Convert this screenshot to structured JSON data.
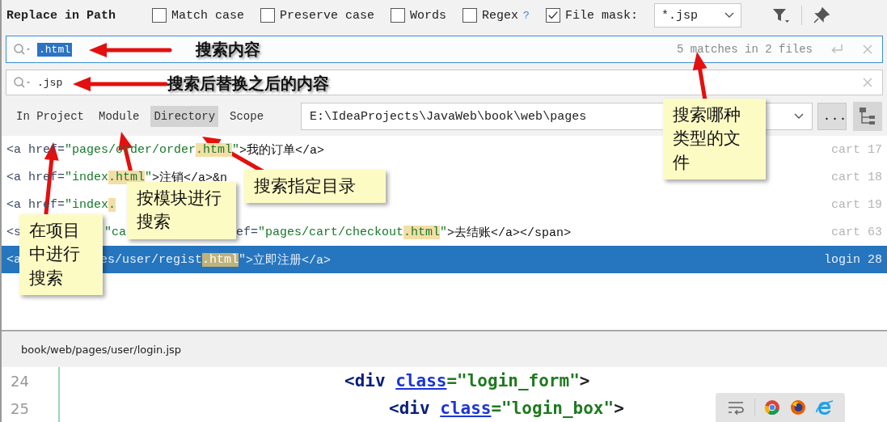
{
  "dialog_title": "Replace in Path",
  "options": [
    {
      "label": "Match case",
      "checked": false
    },
    {
      "label": "Preserve case",
      "checked": false
    },
    {
      "label": "Words",
      "checked": false
    },
    {
      "label": "Regex",
      "checked": false,
      "help": "?"
    },
    {
      "label": "File mask:",
      "checked": true
    }
  ],
  "file_mask": {
    "value": "*.jsp"
  },
  "search_field": {
    "value": ".html",
    "status": "5 matches in 2 files"
  },
  "replace_field": {
    "value": ".jsp"
  },
  "scopes": [
    {
      "label": "In Project",
      "selected": false
    },
    {
      "label": "Module",
      "selected": false
    },
    {
      "label": "Directory",
      "selected": true
    },
    {
      "label": "Scope",
      "selected": false
    }
  ],
  "directory": {
    "value": "E:\\IdeaProjects\\JavaWeb\\book\\web\\pages"
  },
  "more_button": {
    "label": "..."
  },
  "results": [
    {
      "segments": [
        {
          "kind": "tag",
          "text": "<a href="
        },
        {
          "kind": "str",
          "text": "\"pages/order/order"
        },
        {
          "kind": "match",
          "text": ".html"
        },
        {
          "kind": "str",
          "text": "\""
        },
        {
          "kind": "text",
          "text": ">我的订单</a>"
        }
      ],
      "file": "cart",
      "line": "17",
      "selected": false
    },
    {
      "segments": [
        {
          "kind": "tag",
          "text": "<a href="
        },
        {
          "kind": "str",
          "text": "\"index"
        },
        {
          "kind": "match",
          "text": ".html"
        },
        {
          "kind": "str",
          "text": "\""
        },
        {
          "kind": "text",
          "text": ">注销</a>&n"
        }
      ],
      "file": "cart",
      "line": "18",
      "selected": false
    },
    {
      "segments": [
        {
          "kind": "tag",
          "text": "<a href="
        },
        {
          "kind": "str",
          "text": "\"index"
        },
        {
          "kind": "match",
          "text": "."
        }
      ],
      "file": "cart",
      "line": "19",
      "selected": false
    },
    {
      "segments": [
        {
          "kind": "tag",
          "text": "<s"
        },
        {
          "kind": "covered"
        },
        {
          "kind": "str",
          "text": "\"ca"
        },
        {
          "kind": "covered"
        },
        {
          "kind": "tag",
          "text": "ef="
        },
        {
          "kind": "str",
          "text": "\"pages/cart/checkout"
        },
        {
          "kind": "match",
          "text": ".html"
        },
        {
          "kind": "str",
          "text": "\""
        },
        {
          "kind": "text",
          "text": ">去结账</a></span>"
        }
      ],
      "file": "cart",
      "line": "63",
      "selected": false
    },
    {
      "segments": [
        {
          "kind": "tag",
          "text": "<a"
        },
        {
          "kind": "covered"
        },
        {
          "kind": "str",
          "text": "es/user/regist"
        },
        {
          "kind": "match",
          "text": ".html"
        },
        {
          "kind": "str",
          "text": "\""
        },
        {
          "kind": "text",
          "text": ">立即注册</a>"
        }
      ],
      "file": "login",
      "line": "28",
      "selected": true
    }
  ],
  "preview": {
    "path": "book/web/pages/user/login.jsp",
    "lines": [
      {
        "number": "24",
        "segments": [
          {
            "kind": "tag",
            "text": "<div "
          },
          {
            "kind": "attr",
            "text": "class"
          },
          {
            "kind": "str",
            "text": "=\"login_form\""
          },
          {
            "kind": "text",
            "text": ">"
          }
        ]
      },
      {
        "number": "25",
        "segments": [
          {
            "kind": "tag",
            "text": "<div "
          },
          {
            "kind": "attr",
            "text": "class"
          },
          {
            "kind": "str",
            "text": "=\"login_box\""
          },
          {
            "kind": "text",
            "text": ">"
          }
        ]
      }
    ]
  },
  "annotations": [
    {
      "kind": "label",
      "text": "搜索内容"
    },
    {
      "kind": "label",
      "text": "搜索后替换之后的内容"
    },
    {
      "kind": "note",
      "text": "搜索哪种类型的文件"
    },
    {
      "kind": "note",
      "text": "搜索指定目录"
    },
    {
      "kind": "note",
      "text": "按模块进行搜索"
    },
    {
      "kind": "note",
      "text": "在项目中进行搜索"
    }
  ]
}
